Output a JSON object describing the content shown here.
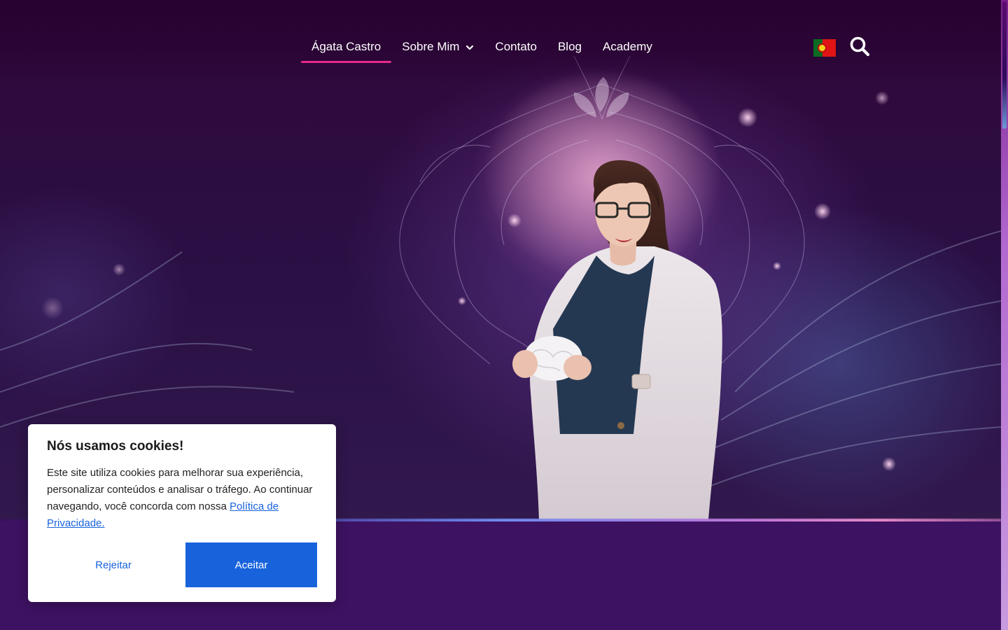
{
  "nav": {
    "items": [
      {
        "label": "Ágata Castro",
        "active": true
      },
      {
        "label": "Sobre Mim",
        "has_dropdown": true
      },
      {
        "label": "Contato"
      },
      {
        "label": "Blog"
      },
      {
        "label": "Academy"
      }
    ],
    "language_flag": "portugal-flag-icon",
    "search_icon": "search-icon",
    "active_underline_color": "#e6288f"
  },
  "hero": {
    "image": "woman-holding-brain-model-photo"
  },
  "cookie": {
    "title": "Nós usamos cookies!",
    "body": "Este site utiliza cookies para melhorar sua experiência, personalizar conteúdos e analisar o tráfego. Ao continuar navegando, você concorda com nossa",
    "link": "Política de Privacidade.",
    "reject": "Rejeitar",
    "accept": "Aceitar",
    "accent": "#1863dc"
  }
}
